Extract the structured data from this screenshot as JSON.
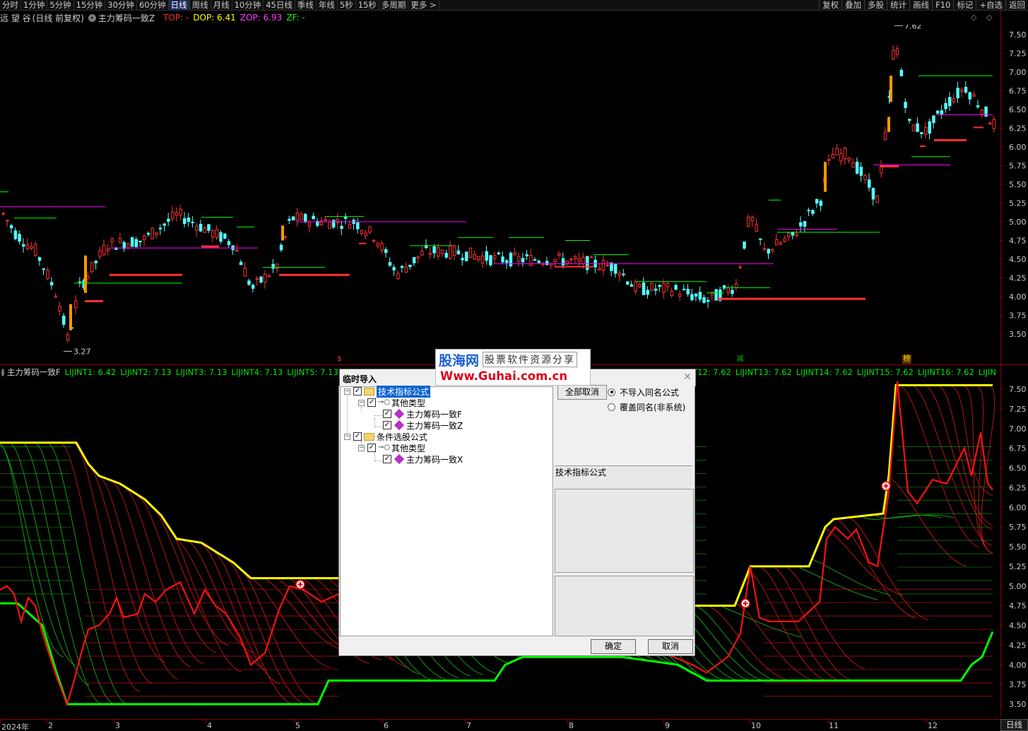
{
  "toolbar": {
    "periods": [
      "分时",
      "1分钟",
      "5分钟",
      "15分钟",
      "30分钟",
      "60分钟",
      "日线",
      "周线",
      "月线",
      "10分钟",
      "45日线",
      "季线",
      "年线",
      "5秒",
      "15秒",
      "多周期",
      "更多 >"
    ],
    "active_period": "日线",
    "right_buttons": [
      "复权",
      "叠加",
      "多股",
      "统计",
      "画线",
      "F10",
      "标记",
      "+自选",
      "返回"
    ]
  },
  "chart_header": {
    "stock": "远 望 谷",
    "mode": "(日线 前复权)",
    "indicator": "主力筹码一致Z",
    "top_label": "TOP: -",
    "dop_label": "DOP: 6.41",
    "zop_label": "ZOP: 6.93",
    "zf_label": "ZF: -"
  },
  "price_axis": {
    "ticks": [
      "7.50",
      "7.25",
      "7.00",
      "6.75",
      "6.50",
      "6.25",
      "6.00",
      "5.75",
      "5.50",
      "5.25",
      "5.00",
      "4.75",
      "4.50",
      "4.25",
      "4.00",
      "3.75",
      "3.50"
    ],
    "high_label": "7.62",
    "low_label": "3.27"
  },
  "markers": [
    {
      "text": "$",
      "color": "#ff3030"
    },
    {
      "text": "减",
      "color": "#00c000"
    },
    {
      "text": "榜",
      "color": "#ffd000"
    }
  ],
  "indicator_header": {
    "title": "主力筹码一致F",
    "values": [
      "LIJINT1: 6.42",
      "LIJINT2: 7.13",
      "LIJINT3: 7.13",
      "LIJINT4: 7.13",
      "LIJINT5: 7.13",
      "LIJINT12: 7.62",
      "LIJINT13: 7.62",
      "LIJINT14: 7.62",
      "LIJINT15: 7.62",
      "LIJINT16: 7.62",
      "LIJIN"
    ]
  },
  "indicator_axis": {
    "ticks": [
      "7.50",
      "7.25",
      "7.00",
      "6.75",
      "6.50",
      "6.25",
      "6.00",
      "5.75",
      "5.50",
      "5.25",
      "5.00",
      "4.75",
      "4.50",
      "4.25",
      "4.00",
      "3.75",
      "3.50"
    ]
  },
  "date_axis": {
    "labels": [
      "2024年",
      "2",
      "3",
      "4",
      "5",
      "6",
      "7",
      "8",
      "9",
      "10",
      "11",
      "12"
    ]
  },
  "bottom_right_button": "日线",
  "watermark": {
    "logo": "股海网",
    "subtitle": "股票软件资源分享",
    "url": "Www.Guhai.com.cn"
  },
  "dialog": {
    "title": "临时导入",
    "tree": [
      {
        "label": "技术指标公式",
        "level": 0,
        "type": "folder",
        "selected": true
      },
      {
        "label": "其他类型",
        "level": 1,
        "type": "group"
      },
      {
        "label": "主力筹码一致F",
        "level": 2,
        "type": "formula"
      },
      {
        "label": "主力筹码一致Z",
        "level": 2,
        "type": "formula"
      },
      {
        "label": "条件选股公式",
        "level": 0,
        "type": "folder"
      },
      {
        "label": "其他类型",
        "level": 1,
        "type": "group"
      },
      {
        "label": "主力筹码一致X",
        "level": 2,
        "type": "formula"
      }
    ],
    "cancel_all_label": "全部取消",
    "radio_options": [
      {
        "label": "不导入同名公式",
        "selected": true
      },
      {
        "label": "覆盖同名(非系统)",
        "selected": false
      }
    ],
    "info_label": "技术指标公式",
    "ok_label": "确定",
    "cancel_label": "取消"
  },
  "colors": {
    "up": "#ff3030",
    "down": "#54ffff",
    "bg": "#000000",
    "axis": "#8b0000",
    "yellow": "#ffff00",
    "green": "#00ff00",
    "magenta": "#ff00ff"
  }
}
